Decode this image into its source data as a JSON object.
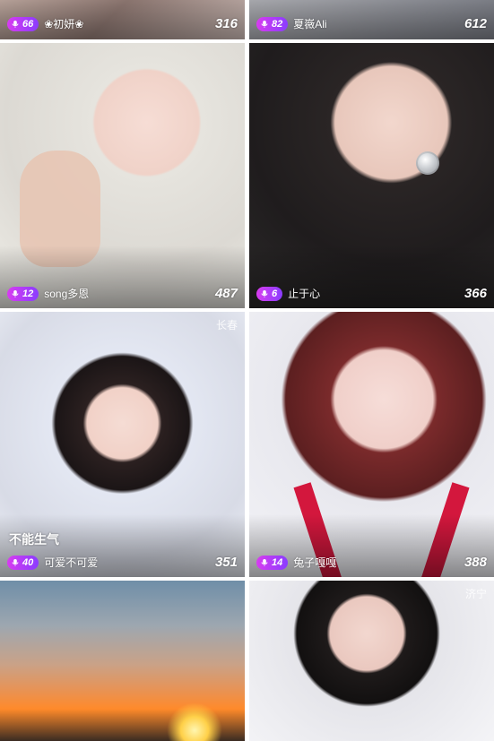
{
  "cards": [
    {
      "badge": "66",
      "name": "❀初妍❀",
      "count": "316"
    },
    {
      "badge": "82",
      "name": "夏嶶Ali",
      "count": "612"
    },
    {
      "badge": "12",
      "name": "song多恩",
      "count": "487"
    },
    {
      "badge": "6",
      "name": "止于心",
      "count": "366"
    },
    {
      "city": "长春",
      "title": "不能生气",
      "badge": "40",
      "name": "可爱不可爱",
      "count": "351"
    },
    {
      "badge": "14",
      "name": "兔子嘎嘎",
      "count": "388"
    },
    {},
    {
      "city": "济宁"
    }
  ],
  "colors": {
    "badge_gradient_start": "#d83cf0",
    "badge_gradient_end": "#8a3cff"
  },
  "icons": {
    "badge_icon": "microphone-icon"
  }
}
